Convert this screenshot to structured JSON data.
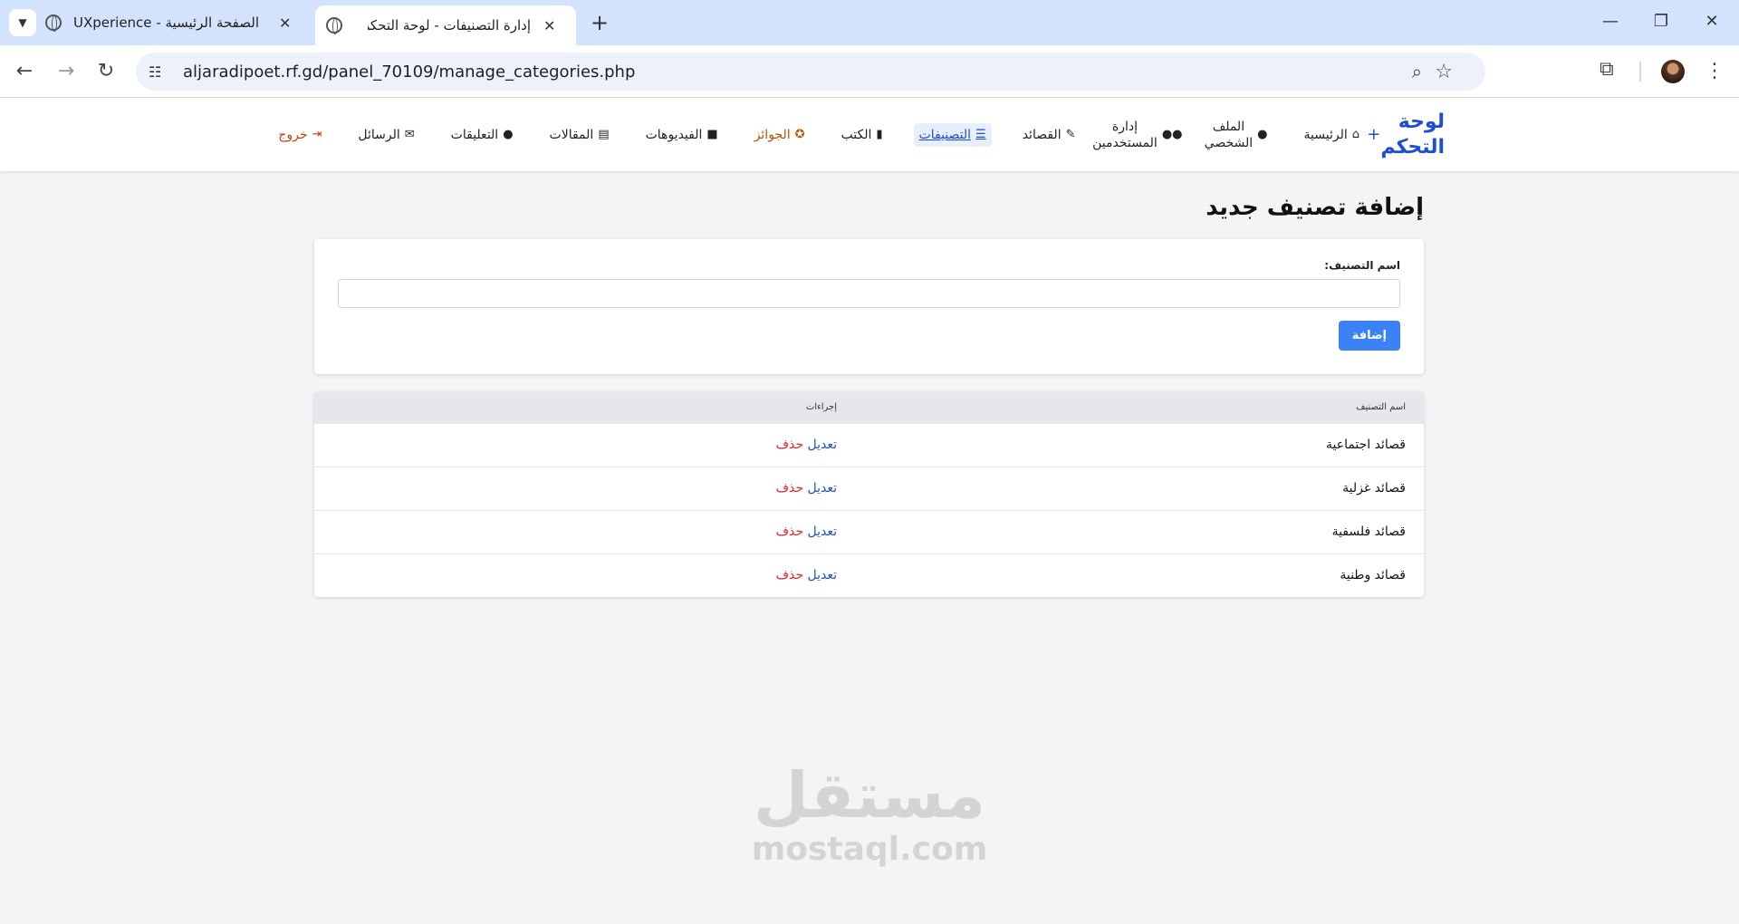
{
  "browser": {
    "tabs": [
      {
        "title": "الصفحة الرئيسية - UXperience",
        "active": false
      },
      {
        "title": "إدارة التصنيفات - لوحة التحكم",
        "active": true
      }
    ],
    "new_tab": "+",
    "url": "aljaradipoet.rf.gd/panel_70109/manage_categories.php"
  },
  "nav": {
    "brand": "لوحة التحكم",
    "brand_plus": "+",
    "items": [
      {
        "label": "الرئيسية",
        "icon": "home-icon"
      },
      {
        "label": "الملف الشخصي",
        "icon": "user-icon"
      },
      {
        "label": "إدارة المستخدمين",
        "icon": "users-icon"
      },
      {
        "label": "القصائد",
        "icon": "feather-icon"
      },
      {
        "label": "التصنيفات",
        "icon": "list-icon",
        "active": true
      },
      {
        "label": "الكتب",
        "icon": "book-icon"
      },
      {
        "label": "الجوائز",
        "icon": "award-icon"
      },
      {
        "label": "الفيديوهات",
        "icon": "video-icon"
      },
      {
        "label": "المقالات",
        "icon": "newspaper-icon"
      },
      {
        "label": "التعليقات",
        "icon": "comments-icon"
      },
      {
        "label": "الرسائل",
        "icon": "envelope-icon"
      },
      {
        "label": "خروج",
        "icon": "logout-icon"
      }
    ]
  },
  "form": {
    "heading": "إضافة تصنيف جديد",
    "name_label": "اسم التصنيف:",
    "name_value": "",
    "submit": "إضافة"
  },
  "table": {
    "headers": [
      "اسم التصنيف",
      "إجراءات"
    ],
    "edit_label": "تعديل",
    "delete_label": "حذف",
    "rows": [
      "قصائد اجتماعية",
      "قصائد غزلية",
      "قصائد فلسفية",
      "قصائد وطنية"
    ]
  },
  "watermark": {
    "arabic": "مستقل",
    "latin": "mostaql.com"
  },
  "colors": {
    "accent": "#3b82f6",
    "brand": "#1d4ed8",
    "delete": "#dc2626",
    "logout": "#c2410c"
  }
}
